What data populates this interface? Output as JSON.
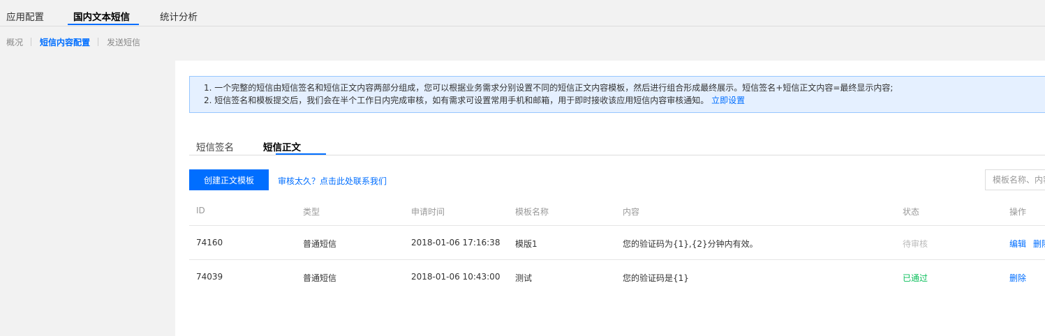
{
  "top_tabs": [
    {
      "label": "应用配置"
    },
    {
      "label": "国内文本短信"
    },
    {
      "label": "统计分析"
    }
  ],
  "sub_nav": [
    {
      "label": "概况"
    },
    {
      "label": "短信内容配置"
    },
    {
      "label": "发送短信"
    }
  ],
  "notice": {
    "line1": "1. 一个完整的短信由短信签名和短信正文内容两部分组成，您可以根据业务需求分别设置不同的短信正文内容模板，然后进行组合形成最终展示。短信签名+短信正文内容=最终显示内容;",
    "line2": "2. 短信签名和模板提交后，我们会在半个工作日内完成审核，如有需求可设置常用手机和邮箱，用于即时接收该应用短信内容审核通知。",
    "link": "立即设置"
  },
  "content_tabs": [
    {
      "label": "短信签名"
    },
    {
      "label": "短信正文"
    }
  ],
  "toolbar": {
    "create_label": "创建正文模板",
    "help_link": "审核太久？点击此处联系我们",
    "search_placeholder": "模板名称、内容"
  },
  "table": {
    "headers": [
      "ID",
      "类型",
      "申请时间",
      "模板名称",
      "内容",
      "状态",
      "操作"
    ],
    "rows": [
      {
        "id": "74160",
        "type": "普通短信",
        "time": "2018-01-06 17:16:38",
        "name": "模版1",
        "content": "您的验证码为{1},{2}分钟内有效。",
        "status": "待审核",
        "actions": [
          "编辑",
          "删除"
        ]
      },
      {
        "id": "74039",
        "type": "普通短信",
        "time": "2018-01-06 10:43:00",
        "name": "测试",
        "content": "您的验证码是{1}",
        "status": "已通过",
        "actions": [
          "删除"
        ]
      }
    ]
  },
  "colors": {
    "accent": "#006eff",
    "notice_bg": "#e5f0ff",
    "status_pass": "#0abf5b",
    "status_pending": "#bbbbbb"
  }
}
